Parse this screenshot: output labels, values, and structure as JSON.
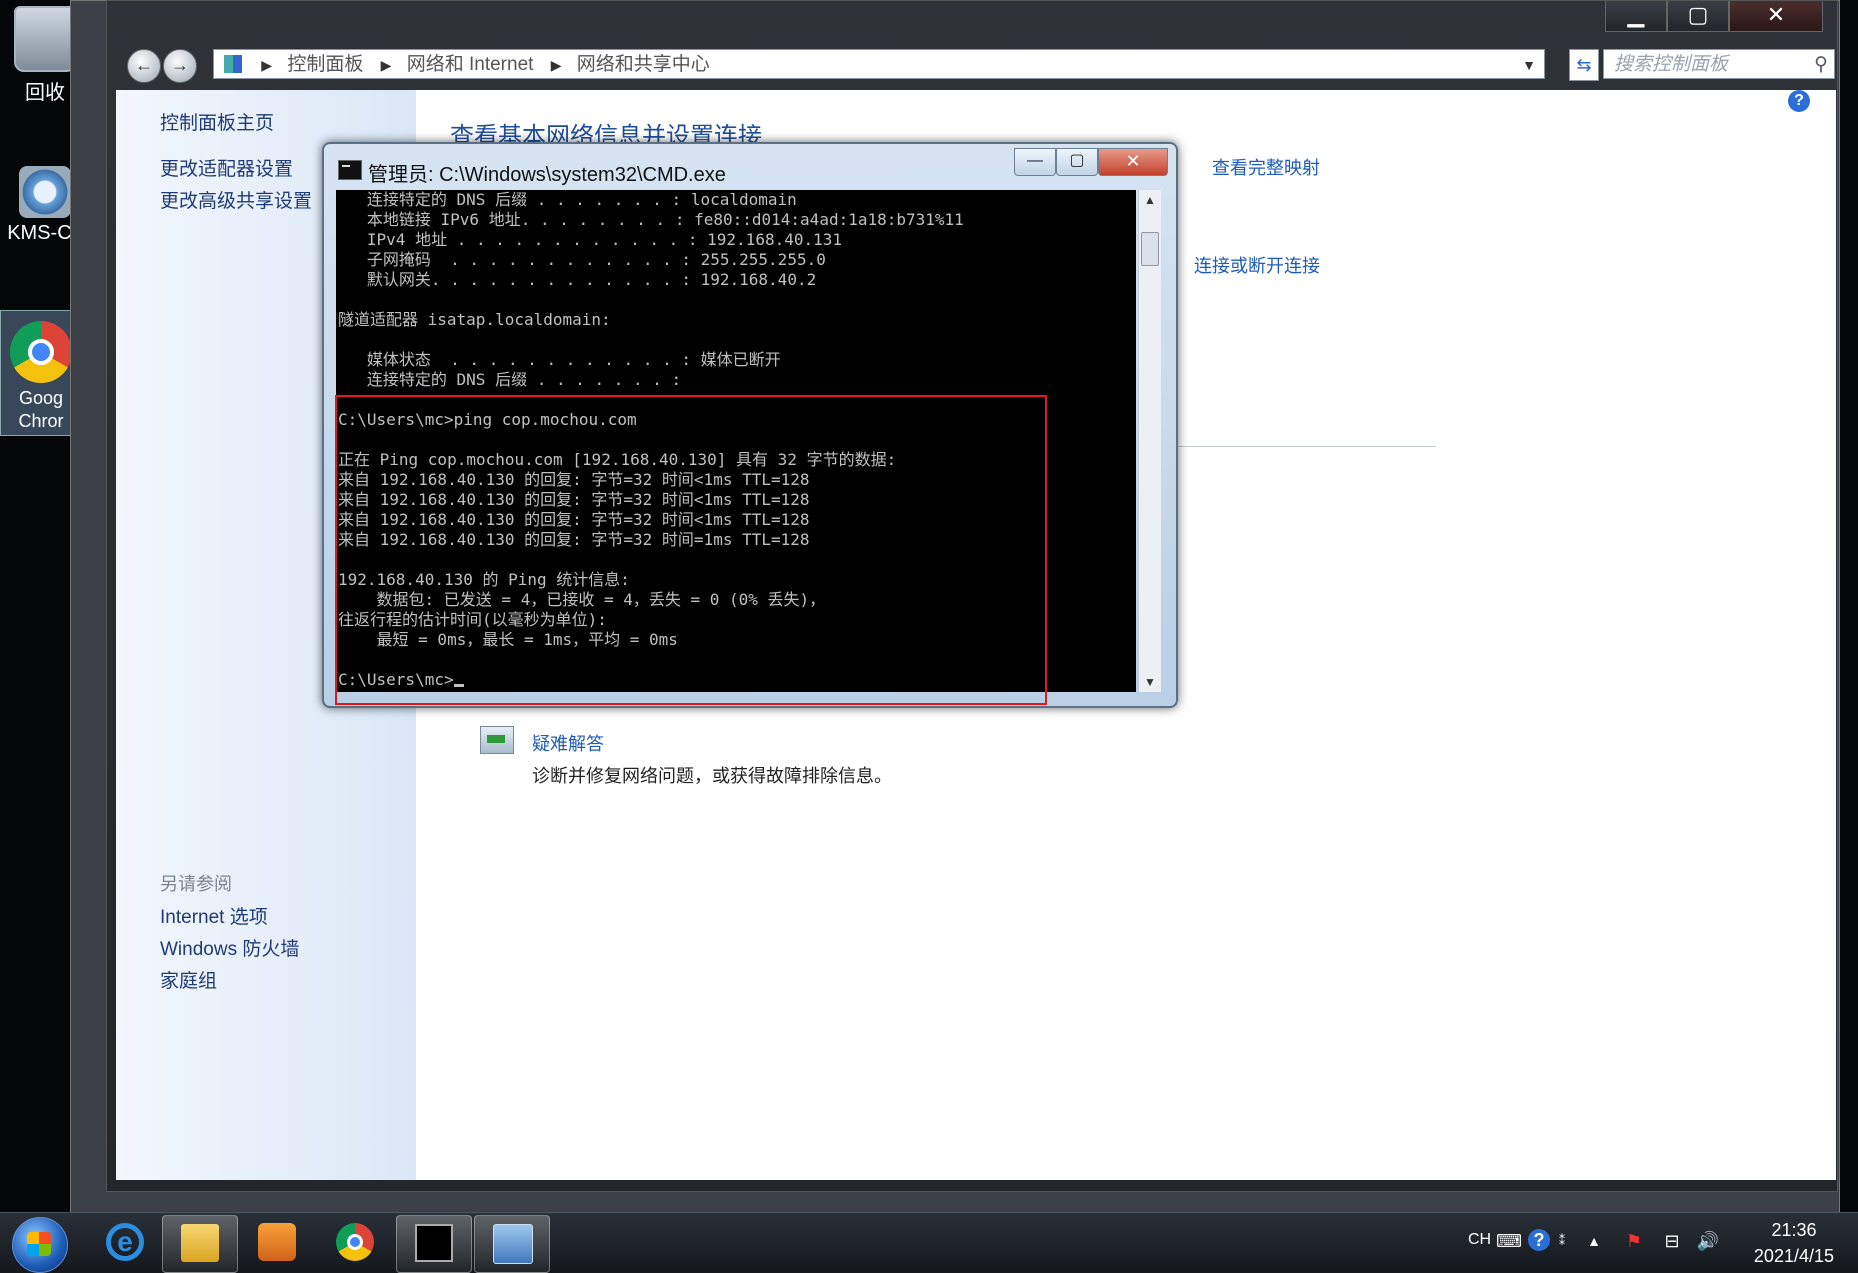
{
  "desktop": {
    "icons": [
      {
        "label": "回收"
      },
      {
        "label": "KMS-Ca"
      },
      {
        "label": "Goog Chror"
      }
    ]
  },
  "explorer": {
    "caption": {
      "minimize": "▁",
      "maximize": "▢",
      "close": "✕"
    },
    "breadcrumbs": [
      "控制面板",
      "网络和 Internet",
      "网络和共享中心"
    ],
    "search_placeholder": "搜索控制面板",
    "sidebar": {
      "home": "控制面板主页",
      "adapter": "更改适配器设置",
      "advanced_sharing": "更改高级共享设置",
      "see_also_header": "另请参阅",
      "see_also": [
        "Internet 选项",
        "Windows 防火墙",
        "家庭组"
      ]
    },
    "main": {
      "title": "查看基本网络信息并设置连接",
      "full_map": "查看完整映射",
      "connect_disconnect": "连接或断开连接",
      "troubleshoot_title": "疑难解答",
      "troubleshoot_desc": "诊断并修复网络问题，或获得故障排除信息。"
    }
  },
  "cmd": {
    "title": "管理员: C:\\Windows\\system32\\CMD.exe",
    "buttons": {
      "minimize": "—",
      "maximize": "▢",
      "close": "✕"
    },
    "lines": [
      "   连接特定的 DNS 后缀 . . . . . . . : localdomain",
      "   本地链接 IPv6 地址. . . . . . . . : fe80::d014:a4ad:1a18:b731%11",
      "   IPv4 地址 . . . . . . . . . . . . : 192.168.40.131",
      "   子网掩码  . . . . . . . . . . . . : 255.255.255.0",
      "   默认网关. . . . . . . . . . . . . : 192.168.40.2",
      "",
      "隧道适配器 isatap.localdomain:",
      "",
      "   媒体状态  . . . . . . . . . . . . : 媒体已断开",
      "   连接特定的 DNS 后缀 . . . . . . . :",
      "",
      "C:\\Users\\mc>ping cop.mochou.com",
      "",
      "正在 Ping cop.mochou.com [192.168.40.130] 具有 32 字节的数据:",
      "来自 192.168.40.130 的回复: 字节=32 时间<1ms TTL=128",
      "来自 192.168.40.130 的回复: 字节=32 时间<1ms TTL=128",
      "来自 192.168.40.130 的回复: 字节=32 时间<1ms TTL=128",
      "来自 192.168.40.130 的回复: 字节=32 时间=1ms TTL=128",
      "",
      "192.168.40.130 的 Ping 统计信息:",
      "    数据包: 已发送 = 4，已接收 = 4，丢失 = 0 (0% 丢失)，",
      "往返行程的估计时间(以毫秒为单位):",
      "    最短 = 0ms，最长 = 1ms，平均 = 0ms",
      ""
    ],
    "prompt": "C:\\Users\\mc>"
  },
  "taskbar": {
    "apps": [
      "ie",
      "explorer",
      "media-player",
      "chrome",
      "cmd",
      "network-center"
    ],
    "tray": {
      "lang": "CH"
    },
    "clock": {
      "time": "21:36",
      "date": "2021/4/15"
    }
  },
  "colors": {
    "highlight": "#e21a1a",
    "link": "#1e5cb8"
  }
}
